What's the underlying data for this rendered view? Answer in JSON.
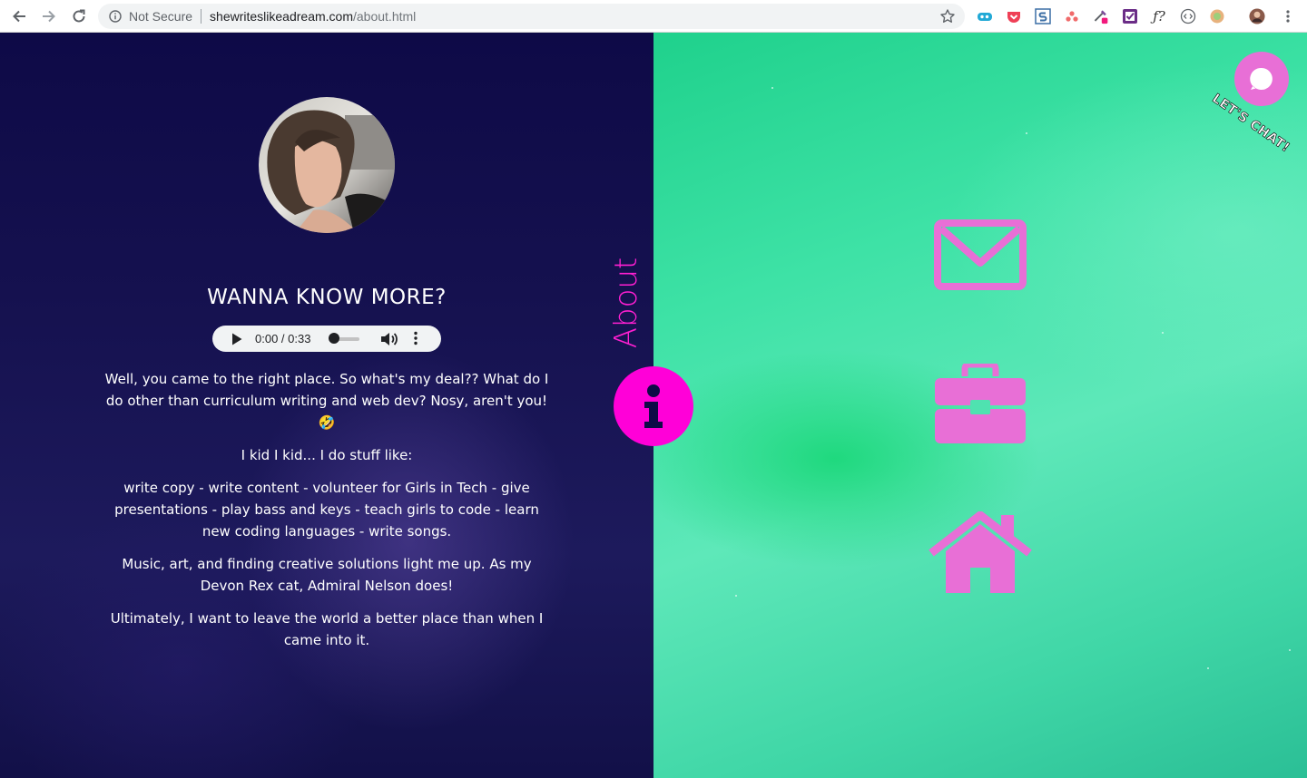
{
  "browser": {
    "security_label": "Not Secure",
    "url_host": "shewriteslikeadream.com",
    "url_path": "/about.html"
  },
  "colors": {
    "accent_pink": "#ff00d8",
    "icon_pink": "#e86fd6",
    "left_bg": "#15114f",
    "right_bg": "#3ee2a6"
  },
  "about": {
    "heading": "WANNA KNOW MORE?",
    "section_label": "About",
    "audio": {
      "time_display": "0:00 / 0:33"
    },
    "paragraphs": [
      "Well, you came to the right place. So what's my deal?? What do I do other than curriculum writing and web dev? Nosy, aren't you! 🤣",
      "I kid I kid... I do stuff like:",
      "write copy - write content - volunteer for Girls in Tech - give presentations - play bass and keys - teach girls to code - learn new coding languages - write songs.",
      "Music, art, and finding creative solutions light me up. As my Devon Rex cat, Admiral Nelson does!",
      "Ultimately, I want to leave the world a better place than when I came into it."
    ]
  },
  "nav": {
    "items": [
      {
        "icon": "envelope-icon"
      },
      {
        "icon": "briefcase-icon"
      },
      {
        "icon": "home-icon"
      }
    ]
  },
  "chat": {
    "label": "LET'S CHAT!"
  }
}
